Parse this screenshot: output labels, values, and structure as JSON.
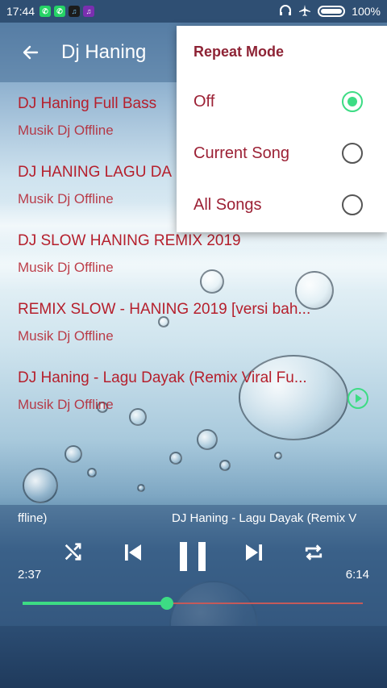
{
  "status_bar": {
    "time": "17:44",
    "battery": "100%"
  },
  "app_bar": {
    "title": "Dj Haning"
  },
  "songs": [
    {
      "title": "DJ Haning Full Bass",
      "artist": "Musik Dj Offline"
    },
    {
      "title": "DJ HANING LAGU DA",
      "artist": "Musik Dj Offline"
    },
    {
      "title": "DJ SLOW HANING REMIX 2019",
      "artist": "Musik Dj Offline"
    },
    {
      "title": "REMIX SLOW - HANING 2019 [versi bah...",
      "artist": "Musik Dj Offline"
    },
    {
      "title": "DJ Haning - Lagu Dayak (Remix Viral Fu...",
      "artist": "Musik Dj Offline"
    }
  ],
  "repeat_menu": {
    "title": "Repeat Mode",
    "options": [
      {
        "label": "Off",
        "selected": true
      },
      {
        "label": "Current Song",
        "selected": false
      },
      {
        "label": "All Songs",
        "selected": false
      }
    ]
  },
  "player": {
    "now_playing_left": "ffline)",
    "now_playing_right": "DJ Haning - Lagu Dayak (Remix V",
    "current_time": "2:37",
    "total_time": "6:14",
    "progress": 0.423
  },
  "colors": {
    "accent": "#3ddc84",
    "song_text": "#b51f2c",
    "menu_text": "#9c2135"
  }
}
